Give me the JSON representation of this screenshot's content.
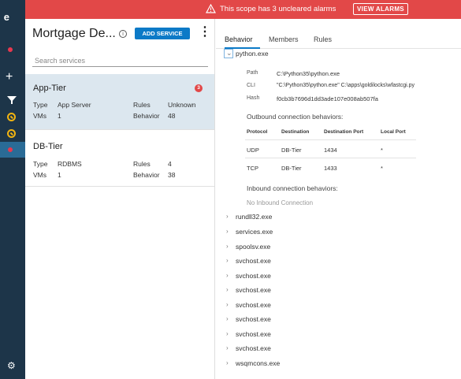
{
  "rail": {
    "logo": "e"
  },
  "banner": {
    "message": "This scope has 3 uncleared alarms",
    "button": "VIEW ALARMS",
    "color": "#e24848"
  },
  "left": {
    "title": "Mortgage De...",
    "add_button": "ADD SERVICE",
    "search_placeholder": "Search services",
    "services": [
      {
        "name": "App-Tier",
        "badge": "3",
        "type_label": "Type",
        "type": "App Server",
        "rules_label": "Rules",
        "rules": "Unknown",
        "vms_label": "VMs",
        "vms": "1",
        "behavior_label": "Behavior",
        "behavior": "48"
      },
      {
        "name": "DB-Tier",
        "type_label": "Type",
        "type": "RDBMS",
        "rules_label": "Rules",
        "rules": "4",
        "vms_label": "VMs",
        "vms": "1",
        "behavior_label": "Behavior",
        "behavior": "38"
      }
    ]
  },
  "right": {
    "tabs": [
      "Behavior",
      "Members",
      "Rules"
    ],
    "expanded": {
      "name": "python.exe",
      "path_label": "Path",
      "path": "C:\\Python35\\python.exe",
      "cli_label": "CLI",
      "cli": "\"C:\\Python35\\python.exe\" C:\\apps\\goldilocks\\wfastcgi.py",
      "hash_label": "Hash",
      "hash": "f0cb3b7696d1dd3ade107e008ab507fa",
      "outbound_title": "Outbound connection behaviors:",
      "columns": [
        "Protocol",
        "Destination",
        "Destination Port",
        "Local Port"
      ],
      "rows": [
        [
          "UDP",
          "DB-Tier",
          "1434",
          "*"
        ],
        [
          "TCP",
          "DB-Tier",
          "1433",
          "*"
        ]
      ],
      "inbound_title": "Inbound connection behaviors:",
      "inbound_empty": "No Inbound Connection"
    },
    "processes": [
      "rundll32.exe",
      "services.exe",
      "spoolsv.exe",
      "svchost.exe",
      "svchost.exe",
      "svchost.exe",
      "svchost.exe",
      "svchost.exe",
      "svchost.exe",
      "svchost.exe",
      "wsqmcons.exe"
    ]
  }
}
